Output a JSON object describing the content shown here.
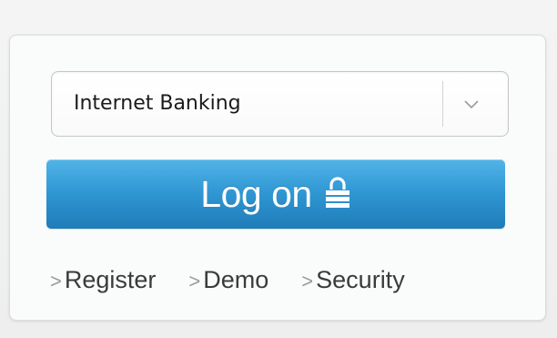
{
  "account_select": {
    "selected": "Internet Banking",
    "dropdown_icon": "chevron-down-icon"
  },
  "logon_button": {
    "label": "Log on",
    "icon": "lock-icon",
    "color": "#2f97d3"
  },
  "links": [
    {
      "arrow": ">",
      "label": "Register"
    },
    {
      "arrow": ">",
      "label": "Demo"
    },
    {
      "arrow": ">",
      "label": "Security"
    }
  ]
}
